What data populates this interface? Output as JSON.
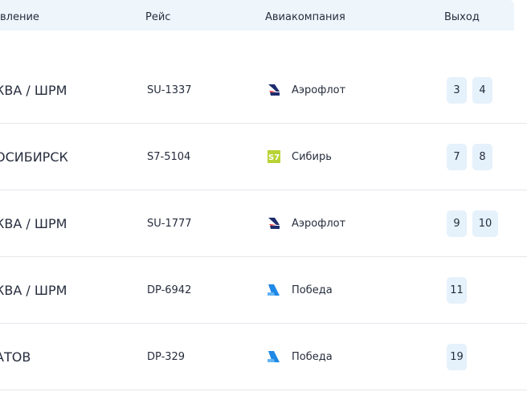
{
  "header": {
    "destination": "вление",
    "flight": "Рейс",
    "airline": "Авиакомпания",
    "gate": "Выход"
  },
  "flights": [
    {
      "destination": "КВА / ШРМ",
      "flight": "SU-1337",
      "airline": "Аэрофлот",
      "logo": "aeroflot-logo-icon",
      "gates": [
        "3",
        "4"
      ]
    },
    {
      "destination": "ОСИБИРСК",
      "flight": "S7-5104",
      "airline": "Сибирь",
      "logo": "s7-logo-icon",
      "gates": [
        "7",
        "8"
      ]
    },
    {
      "destination": "КВА / ШРМ",
      "flight": "SU-1777",
      "airline": "Аэрофлот",
      "logo": "aeroflot-logo-icon",
      "gates": [
        "9",
        "10"
      ]
    },
    {
      "destination": "КВА / ШРМ",
      "flight": "DP-6942",
      "airline": "Победа",
      "logo": "pobeda-logo-icon",
      "gates": [
        "11"
      ]
    },
    {
      "destination": "АТОВ",
      "flight": "DP-329",
      "airline": "Победа",
      "logo": "pobeda-logo-icon",
      "gates": [
        "19"
      ]
    }
  ],
  "colors": {
    "header_bg": "#eef6fc",
    "gate_bg": "#e5f1fb",
    "aeroflot_blue": "#1e2d6e",
    "aeroflot_red": "#e31e24",
    "s7_green": "#b8d335",
    "pobeda_blue": "#1e88e5"
  }
}
